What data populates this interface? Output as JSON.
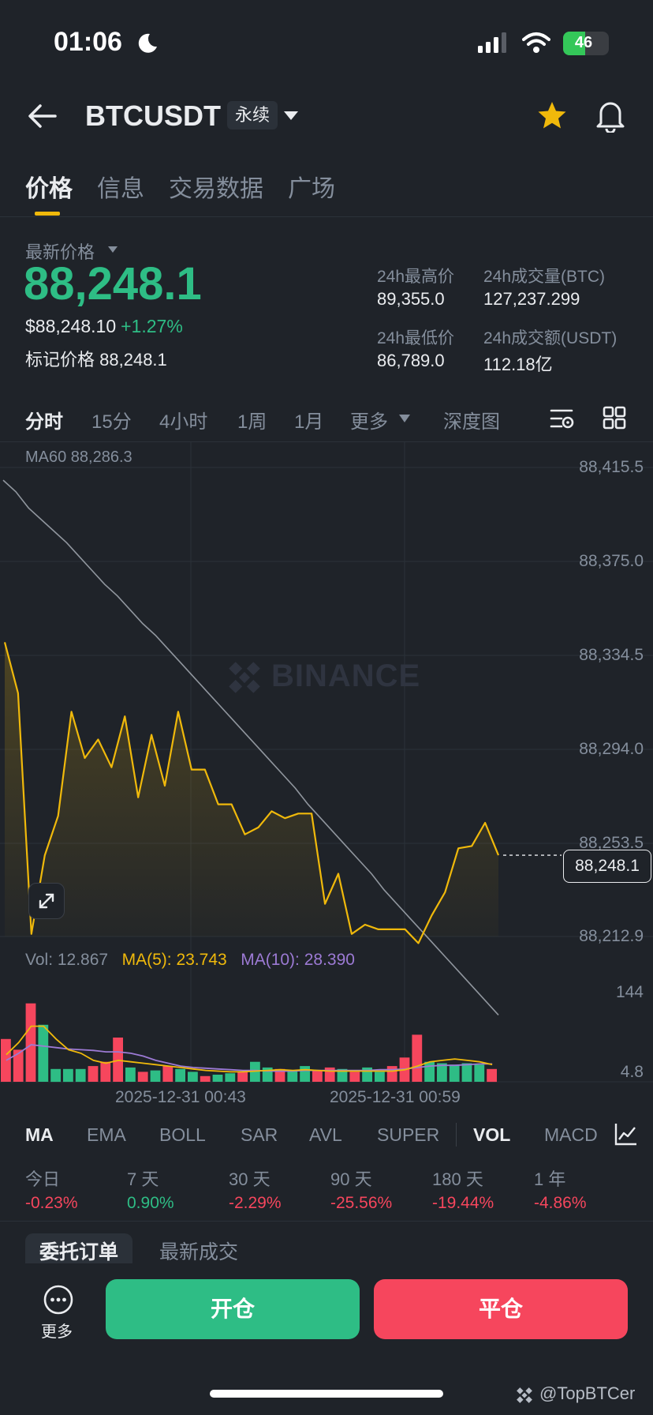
{
  "status": {
    "time": "01:06",
    "battery": "46"
  },
  "header": {
    "symbol": "BTCUSDT",
    "contract_tag": "永续"
  },
  "tabs": [
    "价格",
    "信息",
    "交易数据",
    "广场"
  ],
  "price": {
    "label": "最新价格",
    "last": "88,248.1",
    "usd": "$88,248.10",
    "change": "+1.27%",
    "mark_label": "标记价格",
    "mark_value": "88,248.1"
  },
  "stats": {
    "high_label": "24h最高价",
    "high": "89,355.0",
    "low_label": "24h最低价",
    "low": "86,789.0",
    "vol_btc_label": "24h成交量(BTC)",
    "vol_btc": "127,237.299",
    "vol_usdt_label": "24h成交额(USDT)",
    "vol_usdt": "112.18亿"
  },
  "intervals": [
    "分时",
    "15分",
    "4小时",
    "1周",
    "1月",
    "更多",
    "深度图"
  ],
  "chart": {
    "ma60_label": "MA60 88,286.3",
    "y_ticks": [
      "88,415.5",
      "88,375.0",
      "88,334.5",
      "88,294.0",
      "88,253.5",
      "88,212.9"
    ],
    "current_tag": "88,248.1",
    "watermark": "BINANCE",
    "vol_label": "Vol: 12.867",
    "ma5_label": "MA(5): 23.743",
    "ma10_label": "MA(10): 28.390",
    "vol_ticks": [
      "144",
      "4.8"
    ],
    "x_labels": [
      "2025-12-31 00:43",
      "2025-12-31 00:59"
    ]
  },
  "chart_data": {
    "type": "line",
    "ylim": [
      88212.9,
      88415.5
    ],
    "series": [
      {
        "name": "MA60",
        "values": [
          88410,
          88405,
          88398,
          88393,
          88388,
          88383,
          88377,
          88371,
          88365,
          88360,
          88354,
          88348,
          88343,
          88337,
          88331,
          88325,
          88319,
          88313,
          88307,
          88301,
          88295,
          88289,
          88283,
          88277,
          88270,
          88264,
          88258,
          88252,
          88246,
          88240,
          88233,
          88227,
          88221,
          88215,
          88209,
          88203,
          88197,
          88191,
          88185,
          88179
        ]
      },
      {
        "values": [
          88340,
          88318,
          88214,
          88248,
          88265,
          88310,
          88290,
          88298,
          88286,
          88308,
          88273,
          88300,
          88278,
          88310,
          88285,
          88285,
          88270,
          88270,
          88257,
          88260,
          88267,
          88264,
          88266,
          88266,
          88227,
          88240,
          88214,
          88218,
          88216,
          88216,
          88216,
          88210,
          88222,
          88232,
          88251,
          88252,
          88262,
          88248
        ]
      }
    ],
    "volume": [
      60,
      45,
      110,
      80,
      18,
      18,
      18,
      22,
      28,
      62,
      20,
      14,
      16,
      22,
      18,
      14,
      8,
      10,
      12,
      14,
      28,
      20,
      18,
      16,
      22,
      16,
      20,
      18,
      14,
      20,
      14,
      22,
      34,
      66,
      28,
      26,
      24,
      26,
      24,
      18
    ],
    "volume_up": [
      false,
      false,
      false,
      true,
      true,
      true,
      true,
      false,
      false,
      false,
      true,
      false,
      true,
      false,
      true,
      true,
      false,
      true,
      true,
      false,
      true,
      true,
      false,
      true,
      true,
      false,
      false,
      true,
      false,
      true,
      true,
      false,
      false,
      false,
      true,
      true,
      true,
      true,
      true,
      false
    ],
    "ma5": [
      38,
      55,
      78,
      78,
      60,
      45,
      40,
      30,
      26,
      30,
      28,
      26,
      24,
      22,
      20,
      18,
      16,
      15,
      14,
      14,
      15,
      16,
      17,
      16,
      17,
      16,
      15,
      15,
      15,
      15,
      15,
      15,
      17,
      22,
      28,
      30,
      32,
      30,
      28,
      24
    ],
    "ma10": [
      30,
      40,
      52,
      50,
      48,
      46,
      45,
      44,
      42,
      42,
      40,
      36,
      30,
      26,
      22,
      20,
      19,
      18,
      17,
      16,
      16,
      15,
      15,
      15,
      16,
      16,
      16,
      16,
      16,
      16,
      17,
      17,
      18,
      20,
      22,
      23,
      23,
      24,
      25,
      25
    ],
    "vol_ylim": [
      4.8,
      144
    ]
  },
  "indicators": [
    "MA",
    "EMA",
    "BOLL",
    "SAR",
    "AVL",
    "SUPER",
    "VOL",
    "MACD"
  ],
  "performance": [
    {
      "label": "今日",
      "value": "-0.23%"
    },
    {
      "label": "7 天",
      "value": "0.90%"
    },
    {
      "label": "30 天",
      "value": "-2.29%"
    },
    {
      "label": "90 天",
      "value": "-25.56%"
    },
    {
      "label": "180 天",
      "value": "-19.44%"
    },
    {
      "label": "1 年",
      "value": "-4.86%"
    }
  ],
  "order_tabs": [
    "委托订单",
    "最新成交"
  ],
  "footer": {
    "more": "更多",
    "open": "开仓",
    "close": "平仓"
  },
  "credit": "@TopBTCer"
}
